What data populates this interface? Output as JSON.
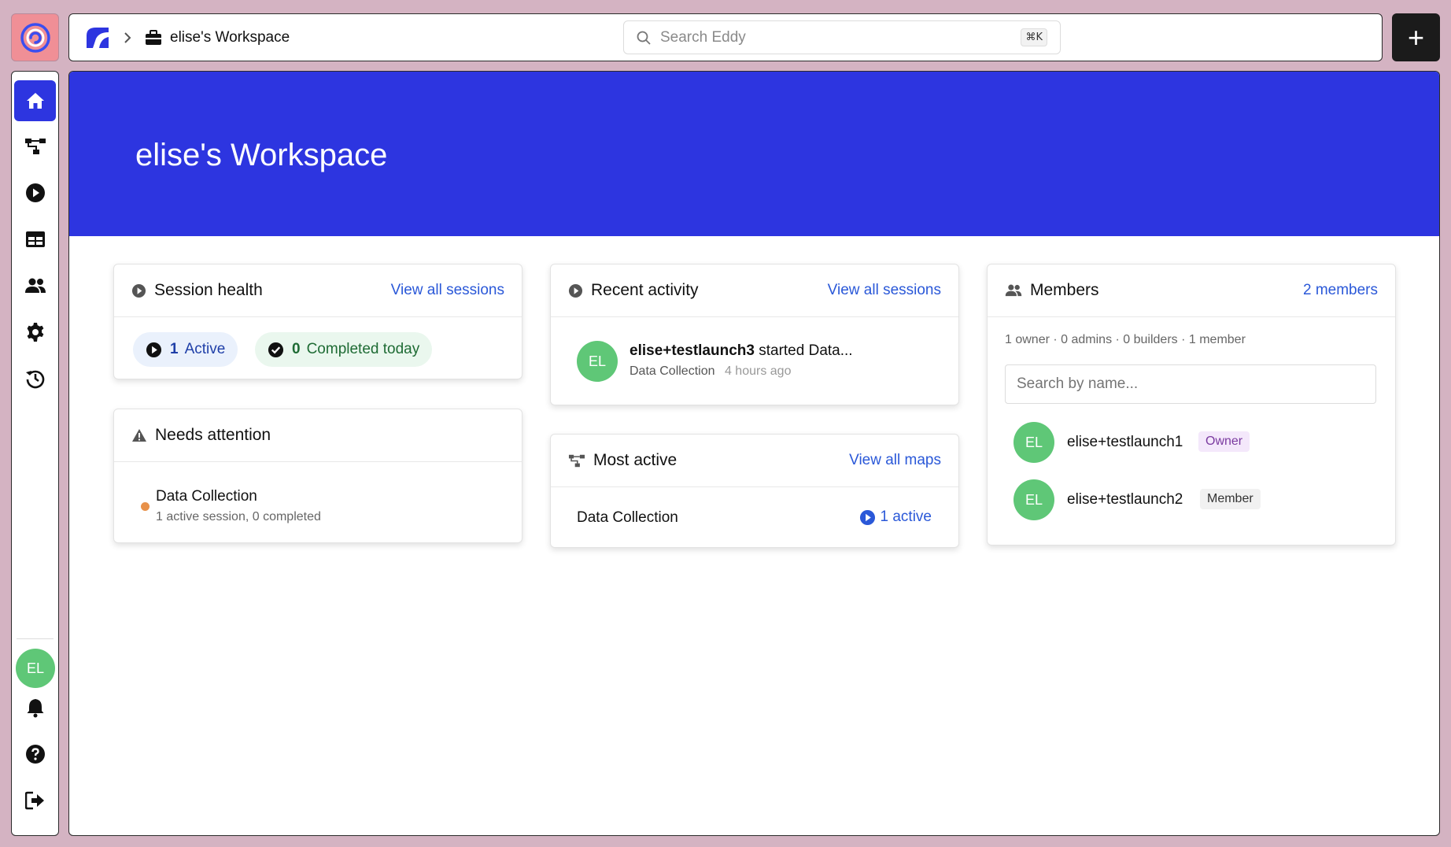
{
  "topbar": {
    "breadcrumb": "elise's Workspace",
    "search_placeholder": "Search Eddy",
    "search_shortcut": "⌘K",
    "add_label": "+"
  },
  "sidebar": {
    "items": [
      {
        "name": "home",
        "icon": "home-icon"
      },
      {
        "name": "maps",
        "icon": "map-icon"
      },
      {
        "name": "sessions",
        "icon": "play-icon"
      },
      {
        "name": "tables",
        "icon": "table-icon"
      },
      {
        "name": "members",
        "icon": "users-icon"
      },
      {
        "name": "settings",
        "icon": "gear-icon"
      },
      {
        "name": "history",
        "icon": "history-icon"
      }
    ],
    "user_initials": "EL"
  },
  "hero": {
    "title": "elise's Workspace"
  },
  "session_health": {
    "title": "Session health",
    "link": "View all sessions",
    "active_count": "1",
    "active_label": "Active",
    "completed_count": "0",
    "completed_label": "Completed today"
  },
  "needs_attention": {
    "title": "Needs attention",
    "item_title": "Data Collection",
    "item_sub": "1 active session, 0 completed"
  },
  "recent_activity": {
    "title": "Recent activity",
    "link": "View all sessions",
    "avatar": "EL",
    "user": "elise+testlaunch3",
    "action": " started Data...",
    "map": "Data Collection",
    "time": "4 hours ago"
  },
  "most_active": {
    "title": "Most active",
    "link": "View all maps",
    "item": "Data Collection",
    "active": "1 active"
  },
  "members": {
    "title": "Members",
    "link": "2 members",
    "summary": "1 owner · 0 admins · 0 builders · 1 member",
    "search_placeholder": "Search by name...",
    "list": [
      {
        "initials": "EL",
        "name": "elise+testlaunch1",
        "role": "Owner"
      },
      {
        "initials": "EL",
        "name": "elise+testlaunch2",
        "role": "Member"
      }
    ]
  },
  "colors": {
    "accent": "#2d35e0",
    "avatar_green": "#5fc777",
    "link_blue": "#2a58d8",
    "attention_dot": "#e8914a"
  }
}
